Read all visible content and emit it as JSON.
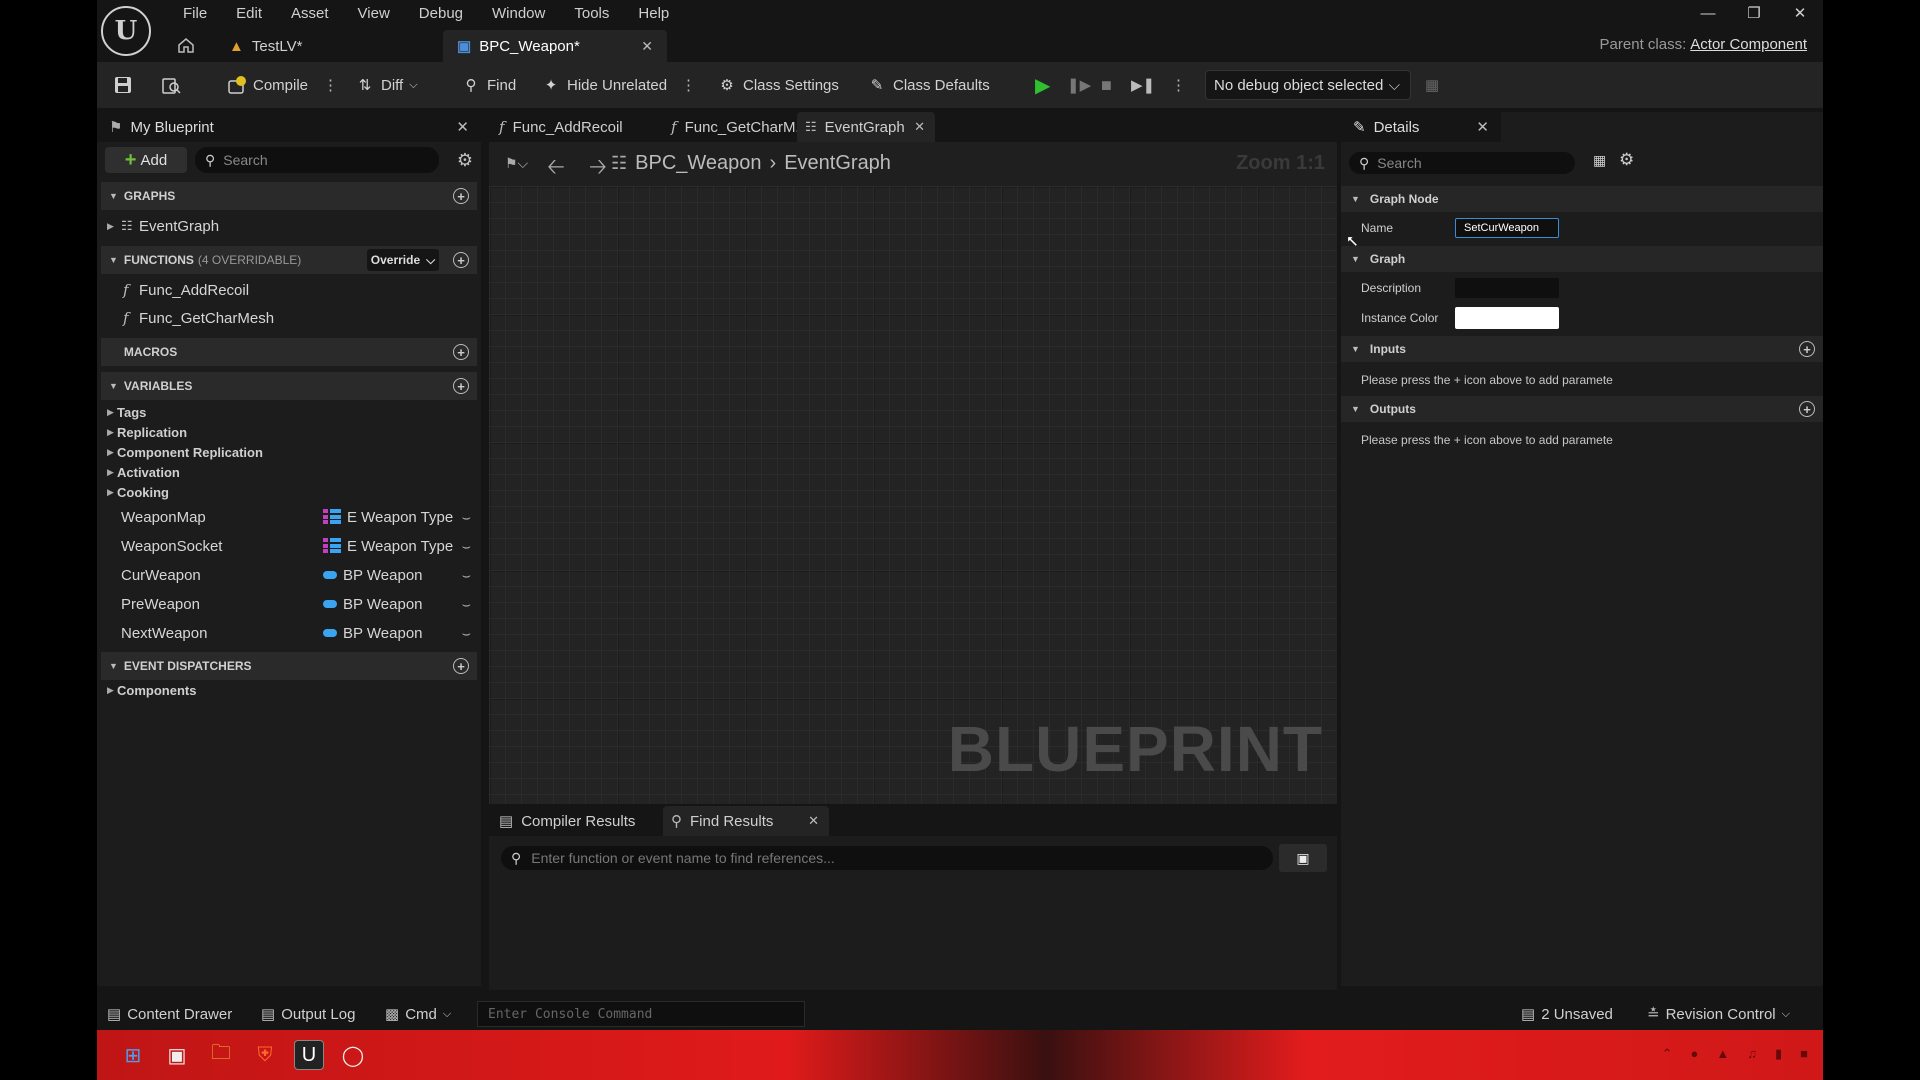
{
  "menu": [
    "File",
    "Edit",
    "Asset",
    "View",
    "Debug",
    "Window",
    "Tools",
    "Help"
  ],
  "tabs": {
    "level": "TestLV*",
    "blueprint": "BPC_Weapon*"
  },
  "parent_class": {
    "label": "Parent class:",
    "value": "Actor Component"
  },
  "toolbar": {
    "compile": "Compile",
    "diff": "Diff",
    "find": "Find",
    "hide_unrelated": "Hide Unrelated",
    "class_settings": "Class Settings",
    "class_defaults": "Class Defaults",
    "debug_object": "No debug object selected"
  },
  "my_blueprint": {
    "title": "My Blueprint",
    "add_label": "Add",
    "search_placeholder": "Search",
    "graphs_header": "GRAPHS",
    "event_graph": "EventGraph",
    "functions_header": "FUNCTIONS",
    "functions_sub": "(4 OVERRIDABLE)",
    "override_label": "Override",
    "functions": [
      "Func_AddRecoil",
      "Func_GetCharMesh"
    ],
    "macros_header": "MACROS",
    "variables_header": "VARIABLES",
    "categories": [
      "Tags",
      "Replication",
      "Component Replication",
      "Activation",
      "Cooking"
    ],
    "variables": [
      {
        "name": "WeaponMap",
        "type": "E Weapon Type",
        "kind": "enum-map"
      },
      {
        "name": "WeaponSocket",
        "type": "E Weapon Type",
        "kind": "enum-map"
      },
      {
        "name": "CurWeapon",
        "type": "BP Weapon",
        "kind": "object"
      },
      {
        "name": "PreWeapon",
        "type": "BP Weapon",
        "kind": "object"
      },
      {
        "name": "NextWeapon",
        "type": "BP Weapon",
        "kind": "object"
      }
    ],
    "dispatchers_header": "EVENT DISPATCHERS",
    "components": "Components"
  },
  "doc_tabs": [
    "Func_AddRecoil",
    "Func_GetCharM...",
    "EventGraph"
  ],
  "graph": {
    "breadcrumb_root": "BPC_Weapon",
    "breadcrumb_leaf": "EventGraph",
    "zoom": "Zoom 1:1",
    "watermark": "BLUEPRINT"
  },
  "bottom": {
    "compiler_results": "Compiler Results",
    "find_results": "Find Results",
    "find_placeholder": "Enter function or event name to find references..."
  },
  "details": {
    "title": "Details",
    "search_placeholder": "Search",
    "graph_node_header": "Graph Node",
    "name_label": "Name",
    "name_value": "SetCurWeapon",
    "graph_header": "Graph",
    "description_label": "Description",
    "instance_color_label": "Instance Color",
    "instance_color": "#ffffff",
    "inputs_header": "Inputs",
    "inputs_note": "Please press the + icon above to add paramete",
    "outputs_header": "Outputs",
    "outputs_note": "Please press the + icon above to add paramete"
  },
  "statusbar": {
    "content_drawer": "Content Drawer",
    "output_log": "Output Log",
    "cmd": "Cmd",
    "console_placeholder": "Enter Console Command",
    "unsaved": "2 Unsaved",
    "revision_control": "Revision Control"
  },
  "colors": {
    "accent_blue": "#3b8bd6",
    "play_green": "#2fbf2f",
    "object_pin": "#3aa4f0",
    "taskbar_red": "#e01a1a"
  }
}
